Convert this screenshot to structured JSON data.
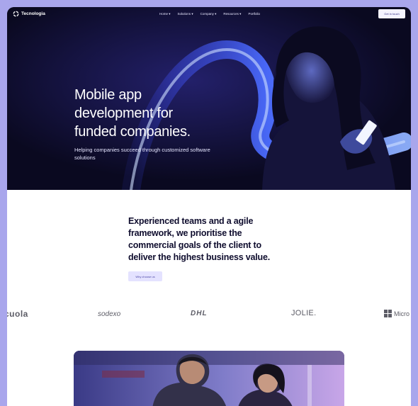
{
  "nav": {
    "brand": "Tecnologia",
    "links": [
      "Home",
      "Solutions",
      "Company",
      "Resources",
      "Portfolio"
    ],
    "cta": "Get in touch"
  },
  "hero": {
    "title_lines": [
      "Mobile app",
      "development for",
      "funded companies."
    ],
    "subtitle": "Helping companies succeed through customized software solutions"
  },
  "mission": {
    "lines": [
      "Experienced teams and a agile",
      "framework, we prioritise the",
      "commercial goals of the client to",
      "deliver the highest business value."
    ],
    "button": "Why choose us"
  },
  "logos": {
    "items": [
      "cuola",
      "sodexo",
      "DHL",
      "JOLIE.",
      "Micro"
    ]
  },
  "colors": {
    "page_border": "#a9a6ec",
    "hero_bg": "#0c0a26",
    "accent": "#4a45a6"
  }
}
